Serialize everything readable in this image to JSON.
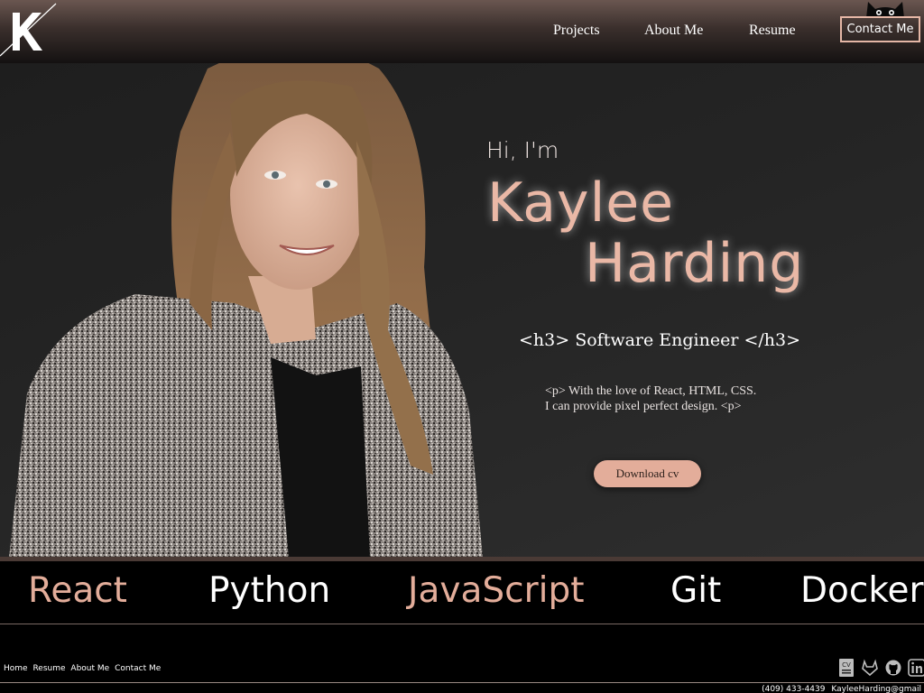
{
  "header": {
    "logo_letter": "K",
    "nav": {
      "projects": "Projects",
      "about": "About Me",
      "resume": "Resume"
    },
    "contact_button": "Contact Me"
  },
  "hero": {
    "greeting": "Hi, I'm",
    "first_name": "Kaylee",
    "last_name": "Harding",
    "role": "<h3> Software Engineer </h3>",
    "tagline_line1": "<p> With the love of React, HTML, CSS.",
    "tagline_line2": "I can provide pixel perfect design. <p>",
    "download_button": "Download cv"
  },
  "skills": [
    "React",
    "Python",
    "JavaScript",
    "Git",
    "Docker"
  ],
  "footer": {
    "nav": [
      "Home",
      "Resume",
      "About Me",
      "Contact Me"
    ],
    "phone": "(409) 433-4439",
    "email": "KayleeHarding@gmail",
    "icons": [
      "cv-icon",
      "gitlab-icon",
      "github-icon",
      "linkedin-icon"
    ]
  },
  "colors": {
    "accent": "#e3ad9a",
    "name": "#eab8a6",
    "background": "#000000",
    "hero_bg": "#252525"
  }
}
